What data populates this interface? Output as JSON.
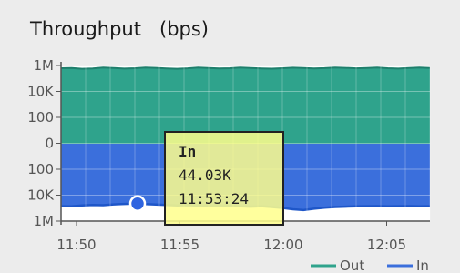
{
  "widget": {
    "title": "Throughput   (bps)"
  },
  "chart_data": {
    "type": "area",
    "title": "Throughput   (bps)",
    "y_tick_labels": [
      "1M",
      "10K",
      "100",
      "0",
      "100",
      "10K",
      "1M"
    ],
    "x_tick_labels": [
      "11:50",
      "11:55",
      "12:00",
      "12:05"
    ],
    "series": [
      {
        "name": "Out",
        "color": "#2fa38c"
      },
      {
        "name": "In",
        "color": "#3b6fdc"
      }
    ],
    "out_levels": [
      620000,
      640000,
      560000,
      600000,
      700000,
      650000,
      580000,
      620000,
      690000,
      660000,
      600000,
      560000,
      610000,
      700000,
      640000,
      590000,
      620000,
      690000,
      650000,
      600000,
      570000,
      620000,
      680000,
      650000,
      600000,
      630000,
      700000,
      660000,
      610000,
      640000,
      690000,
      620000,
      580000,
      640000,
      700000,
      650000
    ],
    "in_levels": [
      70000,
      72000,
      60000,
      55000,
      58000,
      50000,
      46000,
      44030,
      48000,
      52000,
      56000,
      60000,
      58000,
      62000,
      66000,
      60000,
      65000,
      72000,
      76000,
      70000,
      80000,
      95000,
      120000,
      140000,
      110000,
      90000,
      80000,
      76000,
      72000,
      70000,
      68000,
      72000,
      70000,
      68000,
      72000,
      70000
    ],
    "grid": true,
    "legend": "bottom-right",
    "highlight": {
      "series": "In",
      "value": "44.03K",
      "time": "11:53:24"
    }
  },
  "tooltip": {
    "series": "In",
    "value": "44.03K",
    "time": "11:53:24"
  },
  "legend": {
    "items": [
      {
        "label": "Out",
        "color": "#2fa38c"
      },
      {
        "label": "In",
        "color": "#3b6fdc"
      }
    ]
  }
}
